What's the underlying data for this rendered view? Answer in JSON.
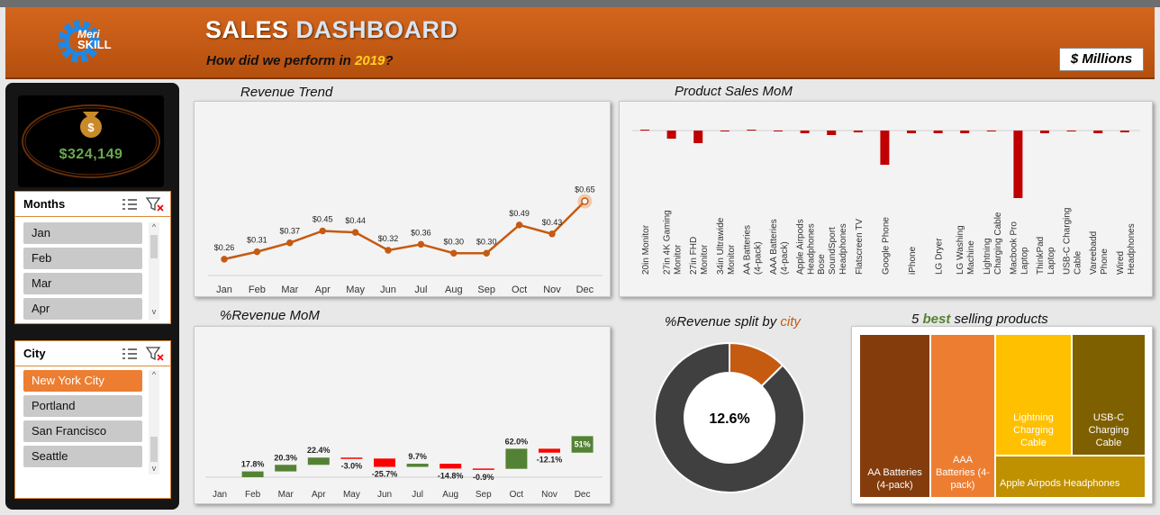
{
  "header": {
    "logo_line1": "Meri",
    "logo_line2": "SKILL",
    "title_part1": "SALES ",
    "title_part2": "DASHBOARD",
    "subtitle_before": "How did we perform in ",
    "subtitle_year": "2019",
    "subtitle_after": "?",
    "unit": "$ Millions"
  },
  "kpi": {
    "total": "$324,149",
    "icon": "money-bag-icon"
  },
  "months_slicer": {
    "title": "Months",
    "items": [
      "Jan",
      "Feb",
      "Mar",
      "Apr"
    ]
  },
  "city_slicer": {
    "title": "City",
    "items": [
      "New York City",
      "Portland",
      "San Francisco",
      "Seattle"
    ],
    "selected": "New York City"
  },
  "panels": {
    "revenue_trend": "Revenue Trend",
    "product_sales": "Product Sales MoM",
    "revenue_mom": "%Revenue MoM",
    "split_before": "%Revenue split by ",
    "split_city": "city",
    "top5_before": "5 ",
    "top5_best": "best",
    "top5_after": " selling products"
  },
  "colors": {
    "accent": "#c55a11",
    "orange": "#ed7d31",
    "green": "#548235",
    "red": "#ff0000",
    "darkred": "#c00000"
  },
  "chart_data": [
    {
      "type": "line",
      "title": "Revenue Trend",
      "categories": [
        "Jan",
        "Feb",
        "Mar",
        "Apr",
        "May",
        "Jun",
        "Jul",
        "Aug",
        "Sep",
        "Oct",
        "Nov",
        "Dec"
      ],
      "values": [
        0.26,
        0.31,
        0.37,
        0.45,
        0.44,
        0.32,
        0.36,
        0.3,
        0.3,
        0.49,
        0.43,
        0.65
      ],
      "labels": [
        "$0.26",
        "$0.31",
        "$0.37",
        "$0.45",
        "$0.44",
        "$0.32",
        "$0.36",
        "$0.30",
        "$0.30",
        "$0.49",
        "$0.43",
        "$0.65"
      ]
    },
    {
      "type": "bar",
      "title": "Product Sales MoM",
      "categories": [
        "20in Monitor",
        "27in 4K Gaming Monitor",
        "27in FHD Monitor",
        "34in Ultrawide Monitor",
        "AA Batteries (4-pack)",
        "AAA Batteries (4-pack)",
        "Apple Airpods Headphones",
        "Bose SoundSport Headphones",
        "Flatscreen TV",
        "Google Phone",
        "iPhone",
        "LG Dryer",
        "LG Washing Machine",
        "Lightning Charging Cable",
        "Macbook Pro Laptop",
        "ThinkPad Laptop",
        "USB-C Charging Cable",
        "Vareebadd Phone",
        "Wired Headphones"
      ],
      "values": [
        0,
        -9,
        -14,
        -1,
        0,
        -1,
        -3,
        -5,
        -2,
        -38,
        -3,
        -3,
        -3,
        -1,
        -75,
        -3,
        -1,
        -3,
        -2
      ]
    },
    {
      "type": "waterfall",
      "title": "%Revenue MoM",
      "categories": [
        "Jan",
        "Feb",
        "Mar",
        "Apr",
        "May",
        "Jun",
        "Jul",
        "Aug",
        "Sep",
        "Oct",
        "Nov",
        "Dec"
      ],
      "values": [
        null,
        17.8,
        20.3,
        22.4,
        -3.0,
        -25.7,
        9.7,
        -14.8,
        -0.9,
        62.0,
        -12.1,
        51
      ],
      "labels": [
        "",
        "17.8%",
        "20.3%",
        "22.4%",
        "-3.0%",
        "-25.7%",
        "9.7%",
        "-14.8%",
        "-0.9%",
        "62.0%",
        "-12.1%",
        "51%"
      ]
    },
    {
      "type": "pie",
      "title": "%Revenue split by city",
      "series": [
        {
          "values": [
            12.6,
            87.4
          ]
        }
      ],
      "center_label": "12.6%"
    },
    {
      "type": "treemap",
      "title": "5 best selling products",
      "items": [
        {
          "label": "AA Batteries (4-pack)",
          "value": 31,
          "color": "#843c0c"
        },
        {
          "label": "AAA Batteries (4-pack)",
          "value": 28,
          "color": "#ed7d31"
        },
        {
          "label": "Lightning Charging Cable",
          "value": 17,
          "color": "#ffc000"
        },
        {
          "label": "USB-C Charging Cable",
          "value": 16,
          "color": "#7f6000"
        },
        {
          "label": "Apple Airpods Headphones",
          "value": 12,
          "color": "#bf9000"
        }
      ]
    }
  ]
}
